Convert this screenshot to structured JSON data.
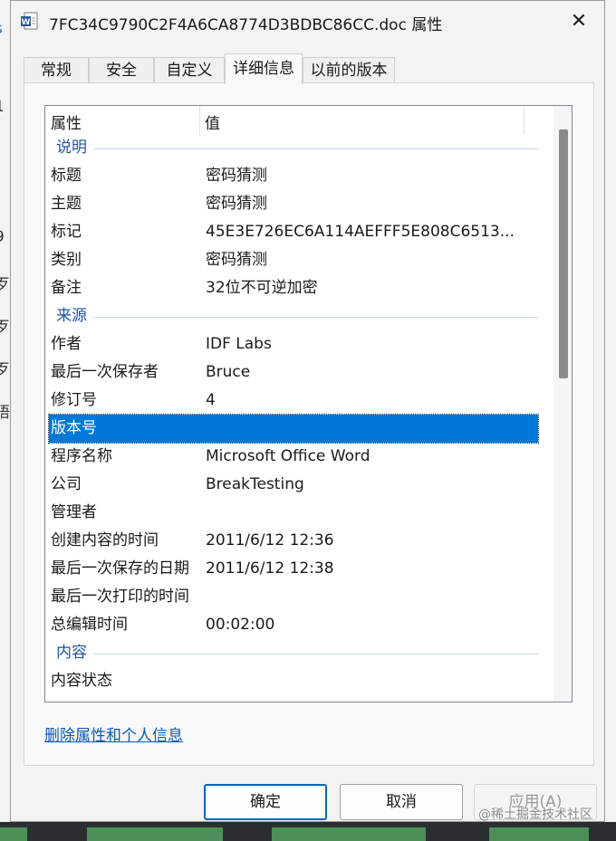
{
  "window": {
    "title": "7FC34C9790C2F4A6CA8774D3BDBC86CC.doc 属性",
    "close_glyph": "✕",
    "icon": "word-document-icon",
    "accent": "#0078d7"
  },
  "tabs": [
    {
      "label": "常规",
      "active": false
    },
    {
      "label": "安全",
      "active": false
    },
    {
      "label": "自定义",
      "active": false
    },
    {
      "label": "详细信息",
      "active": true
    },
    {
      "label": "以前的版本",
      "active": false
    }
  ],
  "table": {
    "header": {
      "property": "属性",
      "value": "值"
    },
    "group_description": "说明",
    "title_key": "标题",
    "title_value": "密码猜测",
    "subject_key": "主题",
    "subject_value": "密码猜测",
    "tags_key": "标记",
    "tags_value": "45E3E726EC6A114AEFFF5E808C6513...",
    "category_key": "类别",
    "category_value": "密码猜测",
    "comments_key": "备注",
    "comments_value": "32位不可逆加密",
    "group_origin": "来源",
    "author_key": "作者",
    "author_value": "IDF Labs",
    "last_saved_by_key": "最后一次保存者",
    "last_saved_by_value": "Bruce",
    "revision_key": "修订号",
    "revision_value": "4",
    "version_key": "版本号",
    "version_value": "",
    "program_key": "程序名称",
    "program_value": "Microsoft Office Word",
    "company_key": "公司",
    "company_value": "BreakTesting",
    "manager_key": "管理者",
    "manager_value": "",
    "created_key": "创建内容的时间",
    "created_value": "2011/6/12 12:36",
    "saved_key": "最后一次保存的日期",
    "saved_value": "2011/6/12 12:38",
    "printed_key": "最后一次打印的时间",
    "printed_value": "",
    "edit_time_key": "总编辑时间",
    "edit_time_value": "00:02:00",
    "group_content": "内容",
    "content_status_key": "内容状态",
    "content_status_value": ""
  },
  "remove_link": "删除属性和个人信息",
  "buttons": {
    "ok": "确定",
    "cancel": "取消",
    "apply": "应用(A)"
  },
  "watermark": "@稀土掘金技术社区",
  "background_fragments": [
    "s",
    "1",
    "9",
    "歹",
    "歹",
    "歹",
    "晤"
  ]
}
